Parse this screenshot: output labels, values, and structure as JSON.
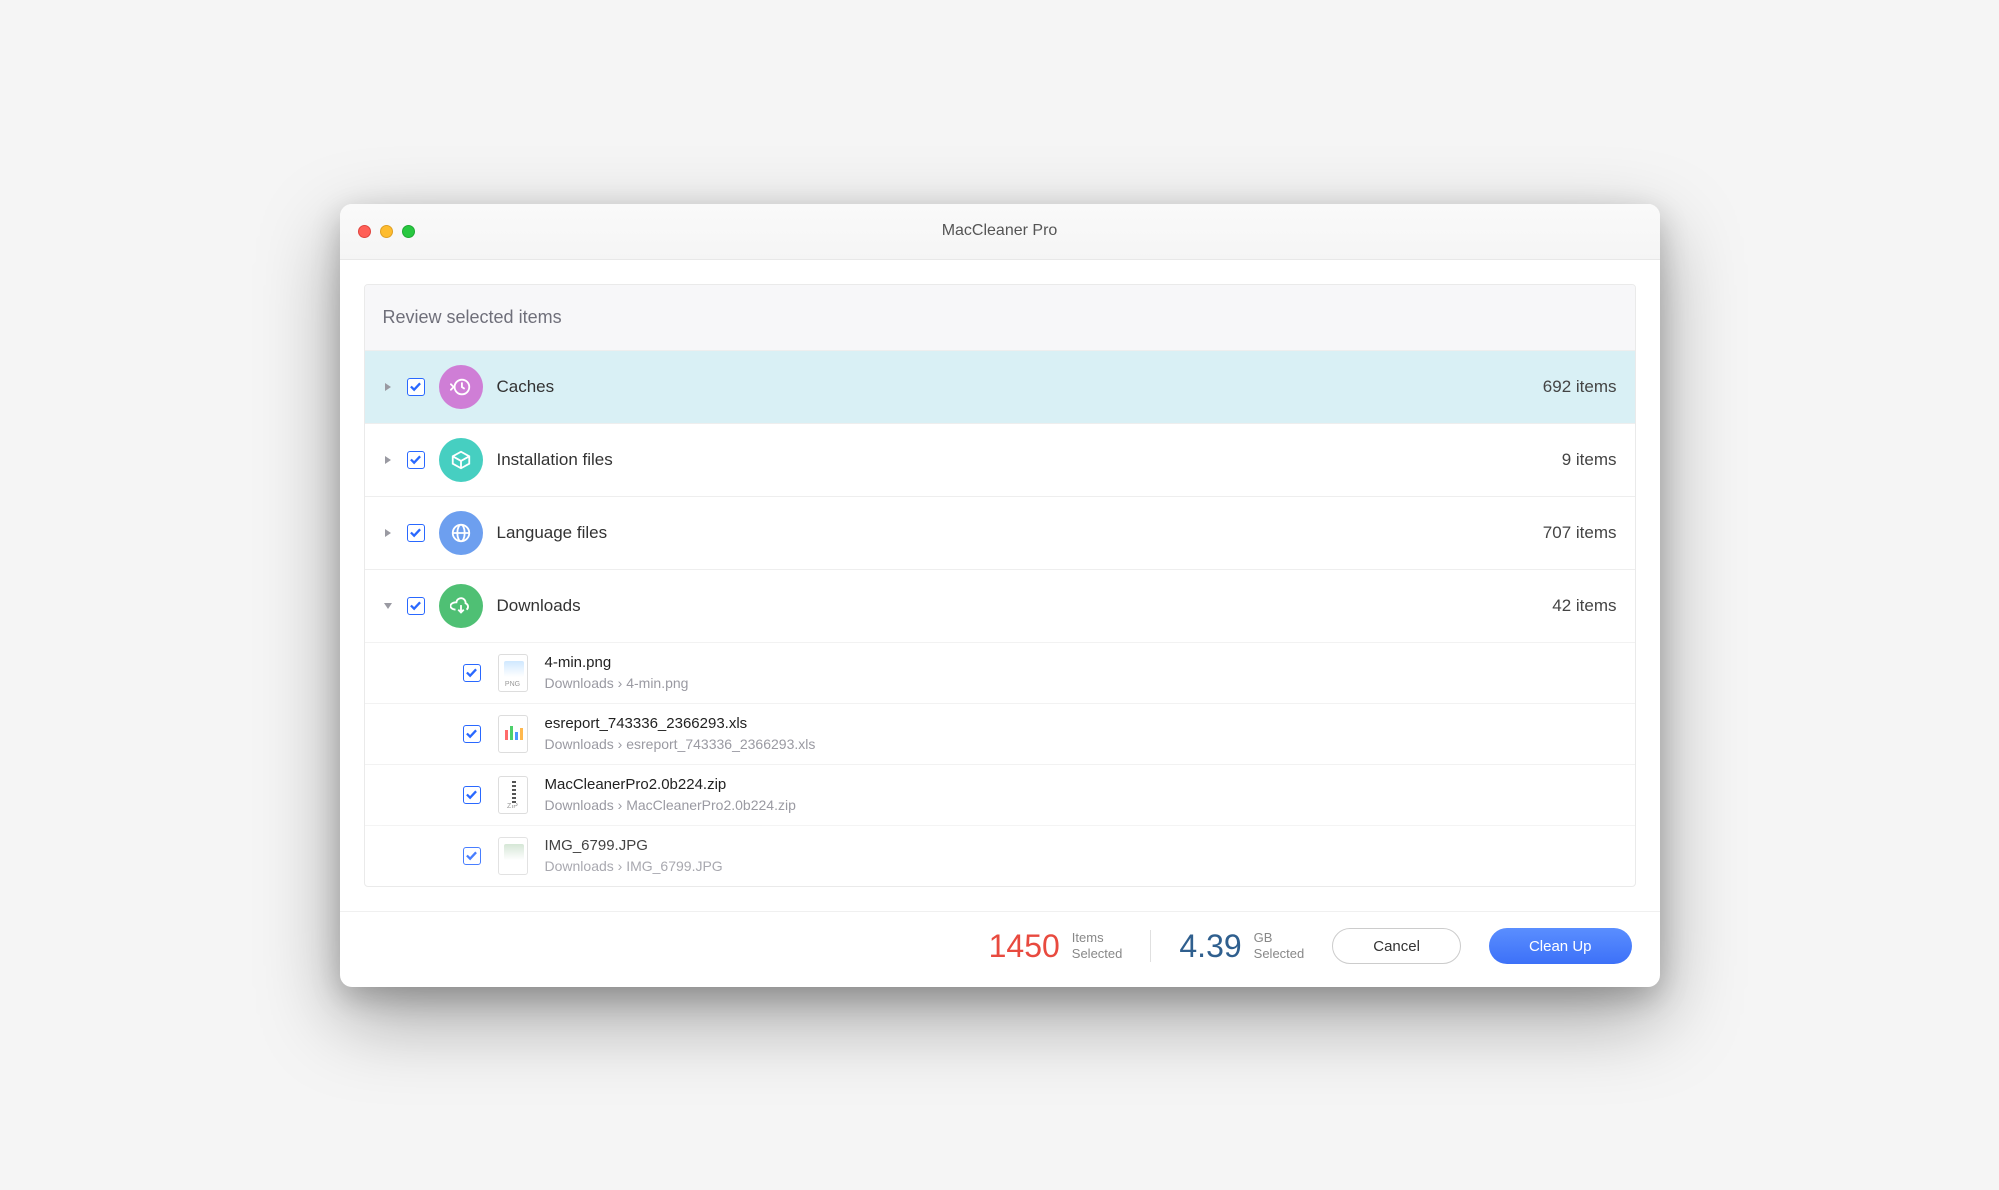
{
  "window": {
    "title": "MacCleaner Pro"
  },
  "panel": {
    "header": "Review selected items"
  },
  "categories": [
    {
      "label": "Caches",
      "count": "692 items",
      "icon": "history",
      "color": "#cf7ed6",
      "checked": true,
      "expanded": false,
      "selected": true
    },
    {
      "label": "Installation files",
      "count": "9 items",
      "icon": "box",
      "color": "#46cfc1",
      "checked": true,
      "expanded": false,
      "selected": false
    },
    {
      "label": "Language files",
      "count": "707 items",
      "icon": "globe",
      "color": "#6d9fef",
      "checked": true,
      "expanded": false,
      "selected": false
    },
    {
      "label": "Downloads",
      "count": "42 items",
      "icon": "download",
      "color": "#4fc074",
      "checked": true,
      "expanded": true,
      "selected": false
    }
  ],
  "downloads_files": [
    {
      "name": "4-min.png",
      "path": "Downloads  ›  4-min.png",
      "type": "PNG",
      "checked": true
    },
    {
      "name": "esreport_743336_2366293.xls",
      "path": "Downloads  ›  esreport_743336_2366293.xls",
      "type": "XLS",
      "checked": true
    },
    {
      "name": "MacCleanerPro2.0b224.zip",
      "path": "Downloads  ›  MacCleanerPro2.0b224.zip",
      "type": "ZIP",
      "checked": true
    },
    {
      "name": "IMG_6799.JPG",
      "path": "Downloads  ›  IMG_6799.JPG",
      "type": "JPG",
      "checked": true
    }
  ],
  "footer": {
    "items_count": "1450",
    "items_label_line1": "Items",
    "items_label_line2": "Selected",
    "size_count": "4.39",
    "size_label_line1": "GB",
    "size_label_line2": "Selected",
    "cancel": "Cancel",
    "cleanup": "Clean Up"
  }
}
